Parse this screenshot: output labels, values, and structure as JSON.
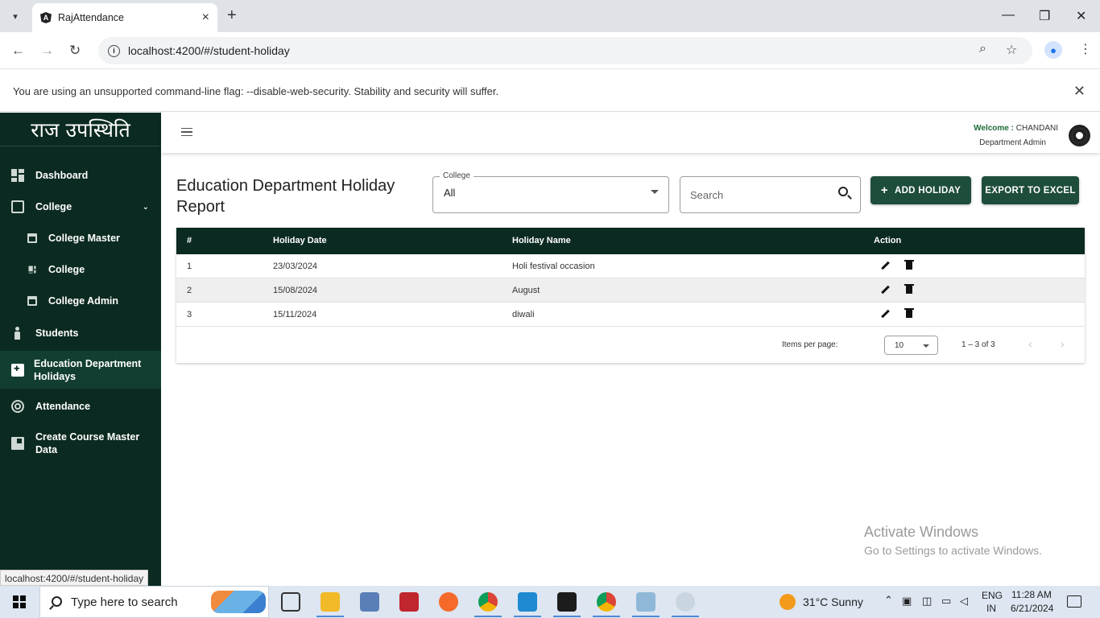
{
  "browser": {
    "tab_title": "RajAttendance",
    "url": "localhost:4200/#/student-holiday",
    "infobar_text": "You are using an unsupported command-line flag: --disable-web-security. Stability and security will suffer."
  },
  "sidebar": {
    "brand": "राज उपस्थिति",
    "items": [
      {
        "label": "Dashboard"
      },
      {
        "label": "College"
      },
      {
        "label": "College Master"
      },
      {
        "label": "College"
      },
      {
        "label": "College Admin"
      },
      {
        "label": "Students"
      },
      {
        "label": "Education Department Holidays"
      },
      {
        "label": "Attendance"
      },
      {
        "label": "Create Course Master Data"
      }
    ],
    "active_index": 6
  },
  "header": {
    "welcome_label": "Welcome :",
    "user_name": "CHANDANI",
    "role": "Department Admin"
  },
  "page": {
    "title": "Education Department Holiday Report",
    "college_label": "College",
    "college_value": "All",
    "search_placeholder": "Search",
    "add_button": "ADD HOLIDAY",
    "export_button": "EXPORT TO EXCEL"
  },
  "table": {
    "columns": [
      "#",
      "Holiday Date",
      "Holiday Name",
      "Action"
    ],
    "rows": [
      {
        "num": "1",
        "date": "23/03/2024",
        "name": "Holi festival occasion"
      },
      {
        "num": "2",
        "date": "15/08/2024",
        "name": "August"
      },
      {
        "num": "3",
        "date": "15/11/2024",
        "name": "diwali"
      }
    ]
  },
  "paginator": {
    "items_per_page_label": "Items per page:",
    "items_per_page": "10",
    "range": "1 – 3 of 3"
  },
  "status_url": "localhost:4200/#/student-holiday",
  "watermark": {
    "line1": "Activate Windows",
    "line2": "Go to Settings to activate Windows."
  },
  "taskbar": {
    "search_placeholder": "Type here to search",
    "weather": "31°C  Sunny",
    "lang1": "ENG",
    "lang2": "IN",
    "time": "11:28 AM",
    "date": "6/21/2024"
  },
  "colors": {
    "sidebar_bg": "#0b2a21",
    "header_row_bg": "#0b2a21",
    "button_bg": "#1e4d3b"
  }
}
